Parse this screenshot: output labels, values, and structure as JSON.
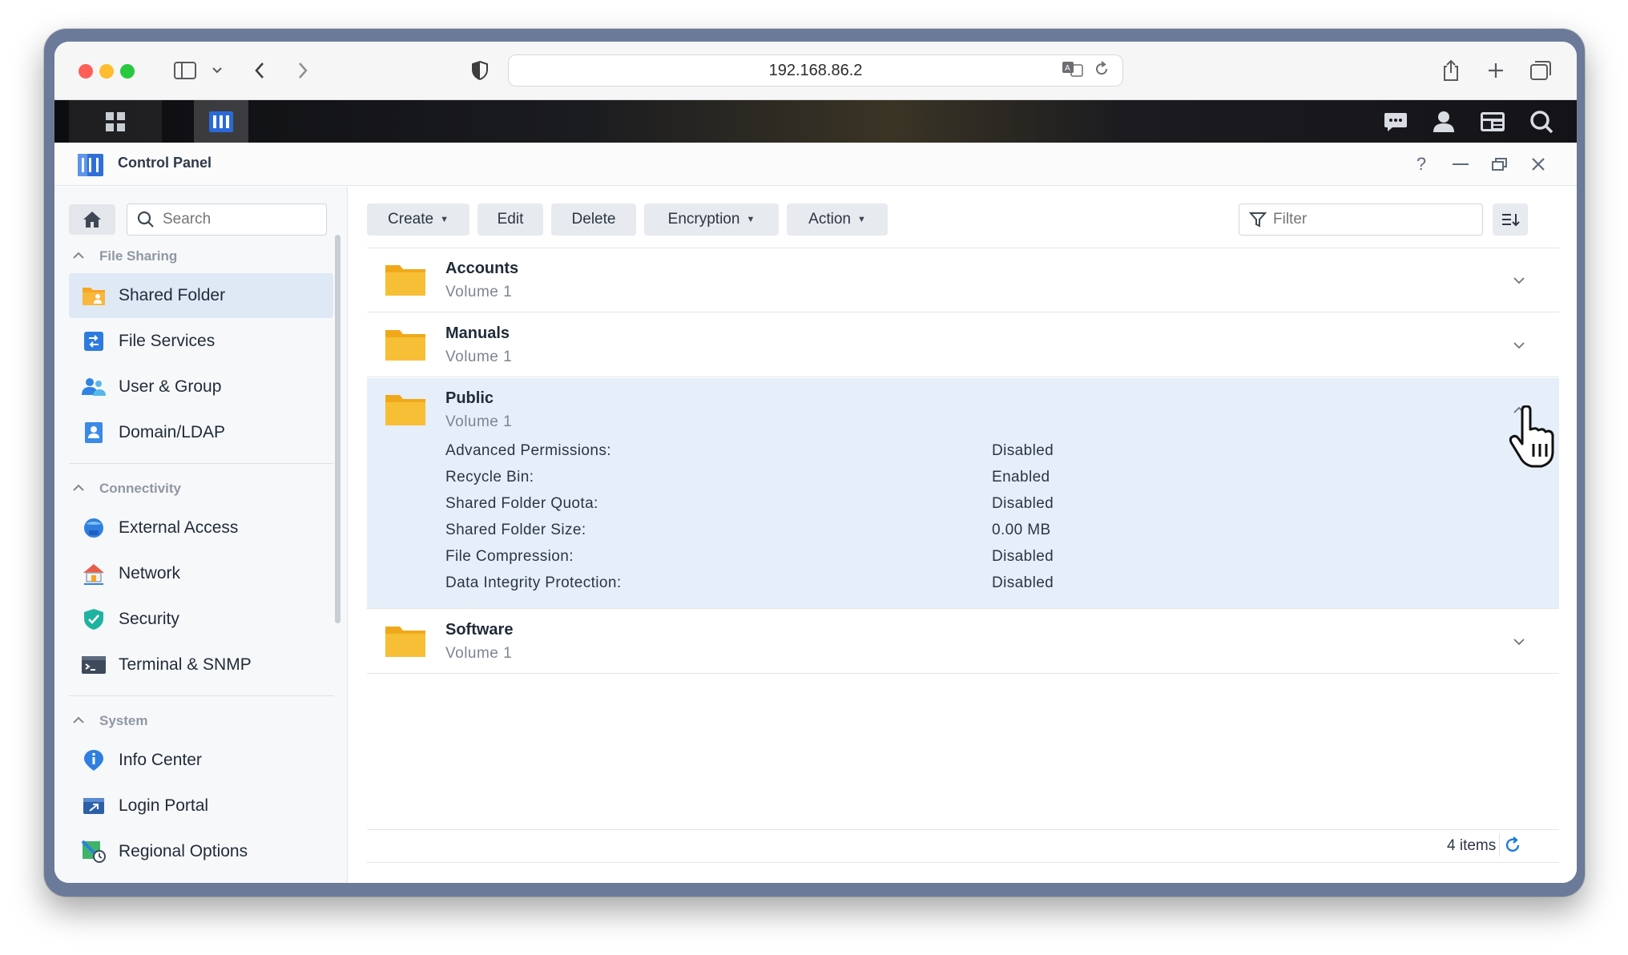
{
  "browser": {
    "url": "192.168.86.2",
    "icons": [
      "sidebar-icon",
      "chevron-down-icon",
      "back-icon",
      "forward-icon",
      "shield-icon",
      "translate-icon",
      "reload-icon",
      "share-icon",
      "new-tab-icon",
      "tabs-overview-icon"
    ]
  },
  "dsm": {
    "taskbar": [
      "main-menu-icon",
      "control-panel-app-icon"
    ],
    "right_icons": [
      "chat-icon",
      "user-icon",
      "widgets-icon",
      "search-icon"
    ]
  },
  "window": {
    "title": "Control Panel",
    "controls": [
      "help-icon",
      "minimize-icon",
      "restore-icon",
      "close-icon"
    ],
    "help_label": "?"
  },
  "sidebar": {
    "search_placeholder": "Search",
    "sections": [
      {
        "title": "File Sharing",
        "items": [
          {
            "label": "Shared Folder",
            "icon": "shared-folder-icon",
            "active": true
          },
          {
            "label": "File Services",
            "icon": "file-services-icon"
          },
          {
            "label": "User & Group",
            "icon": "user-group-icon"
          },
          {
            "label": "Domain/LDAP",
            "icon": "domain-ldap-icon"
          }
        ]
      },
      {
        "title": "Connectivity",
        "items": [
          {
            "label": "External Access",
            "icon": "external-access-icon"
          },
          {
            "label": "Network",
            "icon": "network-icon"
          },
          {
            "label": "Security",
            "icon": "security-shield-icon"
          },
          {
            "label": "Terminal & SNMP",
            "icon": "terminal-icon"
          }
        ]
      },
      {
        "title": "System",
        "items": [
          {
            "label": "Info Center",
            "icon": "info-center-icon"
          },
          {
            "label": "Login Portal",
            "icon": "login-portal-icon"
          },
          {
            "label": "Regional Options",
            "icon": "regional-options-icon"
          }
        ]
      }
    ]
  },
  "toolbar": {
    "create": "Create",
    "edit": "Edit",
    "delete": "Delete",
    "encryption": "Encryption",
    "action": "Action",
    "filter_placeholder": "Filter"
  },
  "folders": [
    {
      "name": "Accounts",
      "volume": "Volume 1"
    },
    {
      "name": "Manuals",
      "volume": "Volume 1"
    },
    {
      "name": "Public",
      "volume": "Volume 1",
      "expanded": true,
      "details": [
        {
          "label": "Advanced Permissions:",
          "value": "Disabled"
        },
        {
          "label": "Recycle Bin:",
          "value": "Enabled"
        },
        {
          "label": "Shared Folder Quota:",
          "value": "Disabled"
        },
        {
          "label": "Shared Folder Size:",
          "value": "0.00 MB"
        },
        {
          "label": "File Compression:",
          "value": "Disabled"
        },
        {
          "label": "Data Integrity Protection:",
          "value": "Disabled"
        }
      ]
    },
    {
      "name": "Software",
      "volume": "Volume 1"
    }
  ],
  "footer": {
    "count": "4 items"
  },
  "colors": {
    "accent": "#1f7ad8",
    "folder": "#f5b829",
    "selected_row": "#e5eef9",
    "active_nav": "#dfe9f5"
  }
}
